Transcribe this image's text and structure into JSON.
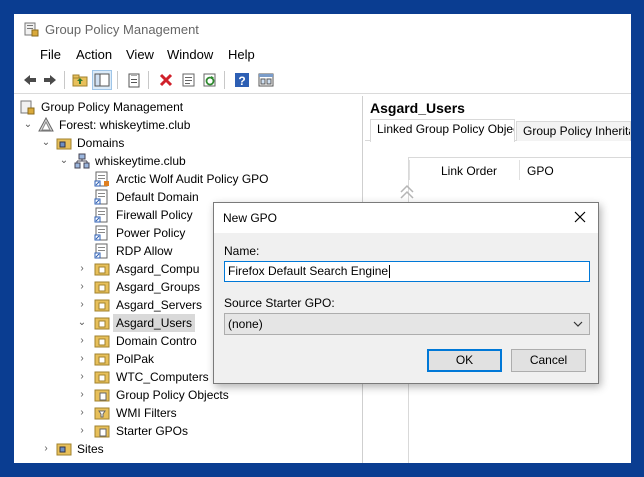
{
  "window": {
    "title": "Group Policy Management"
  },
  "menu": [
    "File",
    "Action",
    "View",
    "Window",
    "Help"
  ],
  "toolbar": {
    "icons": [
      "back-arrow-icon",
      "forward-arrow-icon",
      "up-folder-icon",
      "show-hide-tree-icon",
      "properties-icon",
      "delete-icon",
      "export-list-icon",
      "refresh-icon",
      "help-icon",
      "console-icon"
    ]
  },
  "tree": {
    "root": "Group Policy Management",
    "forest": "Forest: whiskeytime.club",
    "domains": "Domains",
    "domain": "whiskeytime.club",
    "items": [
      "Arctic Wolf Audit Policy GPO",
      "Default Domain",
      "Firewall Policy",
      "Power Policy",
      "RDP Allow",
      "Asgard_Compu",
      "Asgard_Groups",
      "Asgard_Servers",
      "Asgard_Users",
      "Domain Contro",
      "PolPak",
      "WTC_Computers",
      "Group Policy Objects",
      "WMI Filters",
      "Starter GPOs"
    ],
    "sites": "Sites"
  },
  "right": {
    "title": "Asgard_Users",
    "tabs": [
      "Linked Group Policy Objects",
      "Group Policy Inheritan"
    ],
    "columns": [
      "Link Order",
      "GPO"
    ]
  },
  "dialog": {
    "title": "New GPO",
    "name_label": "Name:",
    "name_value": "Firefox Default Search Engine",
    "source_label": "Source Starter GPO:",
    "source_value": "(none)",
    "ok": "OK",
    "cancel": "Cancel"
  }
}
